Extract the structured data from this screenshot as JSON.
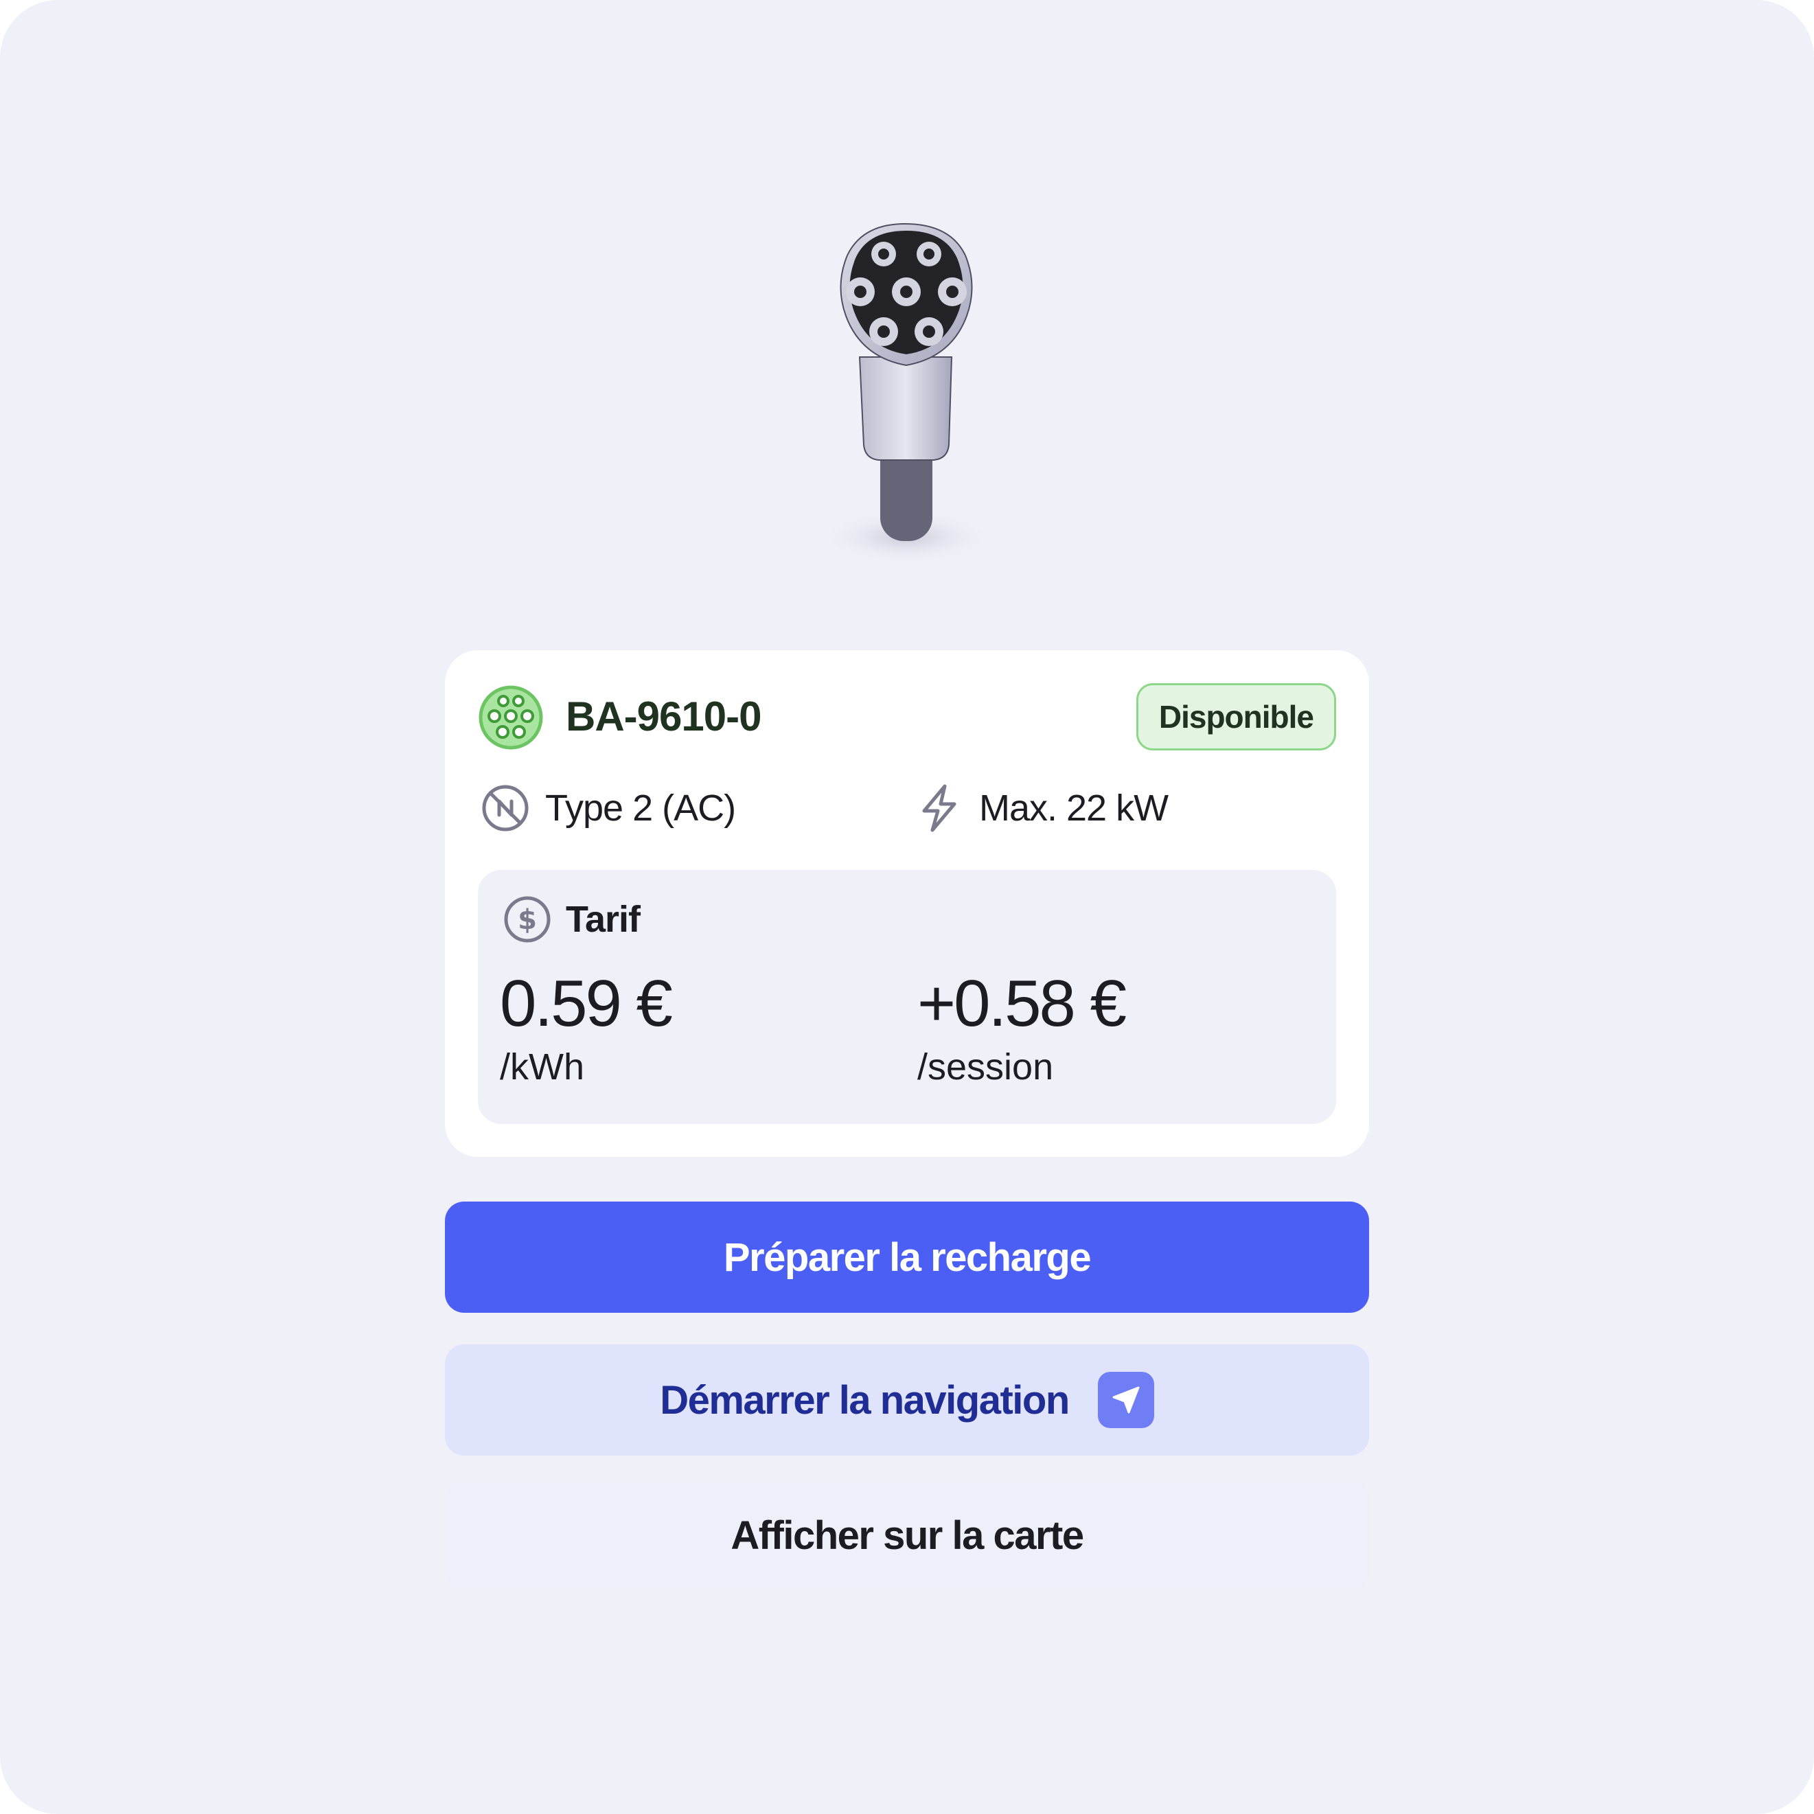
{
  "illustration": {
    "icon": "ev-charging-plug-icon"
  },
  "station": {
    "id": "BA-9610-0",
    "connector_icon": "type2-connector-icon",
    "status": "Disponible",
    "status_color": "#8ed68a"
  },
  "specs": {
    "connector_type": "Type 2 (AC)",
    "connector_type_icon": "ac-current-icon",
    "max_power": "Max. 22 kW",
    "max_power_icon": "lightning-icon"
  },
  "tariff": {
    "title": "Tarif",
    "icon": "dollar-circle-icon",
    "energy_price": "0.59 €",
    "energy_unit": "/kWh",
    "session_price": "+0.58 €",
    "session_unit": "/session"
  },
  "actions": {
    "prepare_label": "Préparer la recharge",
    "navigate_label": "Démarrer la navigation",
    "navigate_icon": "navigation-arrow-icon",
    "map_label": "Afficher sur la carte"
  },
  "colors": {
    "accent": "#4c5ff4",
    "secondary_bg": "#dfe3fb",
    "secondary_text": "#1f2d94",
    "available_green": "#6cc562"
  }
}
